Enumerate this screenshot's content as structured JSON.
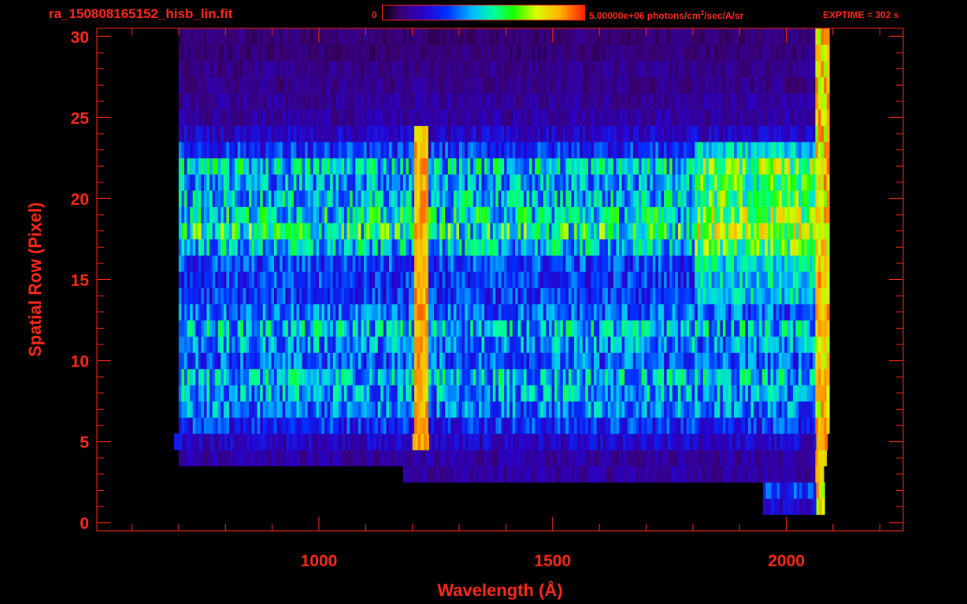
{
  "header": {
    "title": "ra_150808165152_hisb_lin.fit",
    "colorbar_min": "0",
    "colorbar_max_prefix": "5.00000e+06 photons/cm",
    "colorbar_max_exponent": "2",
    "colorbar_max_suffix": "/sec/A/sr",
    "exptime": "EXPTIME = 302 s"
  },
  "colors": {
    "axis": "#ff2a1a",
    "background": "#000000"
  },
  "chart_data": {
    "type": "heatmap",
    "title": "ra_150808165152_hisb_lin.fit",
    "xlabel": "Wavelength (Å)",
    "ylabel": "Spatial Row (Pixel)",
    "xlim": [
      525,
      2250
    ],
    "ylim": [
      -0.5,
      30.5
    ],
    "x_ticks": [
      1000,
      1500,
      2000
    ],
    "y_ticks": [
      0,
      5,
      10,
      15,
      20,
      25,
      30
    ],
    "color_range": [
      0,
      5000000
    ],
    "color_unit": "photons/cm^2/sec/A/sr",
    "colormap": "rainbow",
    "data_x_range": [
      700,
      2090
    ],
    "bright_line_wavelength": 1216,
    "band_rows": [
      {
        "row": 1,
        "x_start": 1950,
        "x_end": 2080,
        "level": 0.2
      },
      {
        "row": 2,
        "x_start": 1950,
        "x_end": 2080,
        "level": 0.3
      },
      {
        "row": 3,
        "x_start": 1180,
        "x_end": 2080,
        "level": 0.15
      },
      {
        "row": 4,
        "x_start": 700,
        "x_end": 2085,
        "level": 0.15
      },
      {
        "row": 5,
        "x_start": 690,
        "x_end": 2085,
        "level": 0.2
      },
      {
        "row": 6,
        "x_start": 700,
        "x_end": 2090,
        "level": 0.3
      },
      {
        "row": 7,
        "x_start": 700,
        "x_end": 2090,
        "level": 0.38
      },
      {
        "row": 8,
        "x_start": 700,
        "x_end": 2090,
        "level": 0.42
      },
      {
        "row": 9,
        "x_start": 700,
        "x_end": 2090,
        "level": 0.45
      },
      {
        "row": 10,
        "x_start": 700,
        "x_end": 2090,
        "level": 0.35
      },
      {
        "row": 11,
        "x_start": 700,
        "x_end": 2090,
        "level": 0.4
      },
      {
        "row": 12,
        "x_start": 700,
        "x_end": 2090,
        "level": 0.45
      },
      {
        "row": 13,
        "x_start": 700,
        "x_end": 2090,
        "level": 0.35
      },
      {
        "row": 14,
        "x_start": 700,
        "x_end": 2090,
        "level": 0.3
      },
      {
        "row": 15,
        "x_start": 700,
        "x_end": 2090,
        "level": 0.3
      },
      {
        "row": 16,
        "x_start": 700,
        "x_end": 2090,
        "level": 0.32
      },
      {
        "row": 17,
        "x_start": 700,
        "x_end": 2090,
        "level": 0.45
      },
      {
        "row": 18,
        "x_start": 700,
        "x_end": 2090,
        "level": 0.55
      },
      {
        "row": 19,
        "x_start": 700,
        "x_end": 2090,
        "level": 0.5
      },
      {
        "row": 20,
        "x_start": 700,
        "x_end": 2090,
        "level": 0.45
      },
      {
        "row": 21,
        "x_start": 700,
        "x_end": 2090,
        "level": 0.42
      },
      {
        "row": 22,
        "x_start": 700,
        "x_end": 2090,
        "level": 0.48
      },
      {
        "row": 23,
        "x_start": 700,
        "x_end": 2090,
        "level": 0.3
      },
      {
        "row": 24,
        "x_start": 700,
        "x_end": 2090,
        "level": 0.2
      },
      {
        "row": 25,
        "x_start": 700,
        "x_end": 2090,
        "level": 0.15
      },
      {
        "row": 26,
        "x_start": 700,
        "x_end": 2090,
        "level": 0.14
      },
      {
        "row": 27,
        "x_start": 700,
        "x_end": 2090,
        "level": 0.12
      },
      {
        "row": 28,
        "x_start": 700,
        "x_end": 2090,
        "level": 0.12
      },
      {
        "row": 29,
        "x_start": 700,
        "x_end": 2090,
        "level": 0.1
      },
      {
        "row": 30,
        "x_start": 700,
        "x_end": 2090,
        "level": 0.1
      }
    ]
  }
}
